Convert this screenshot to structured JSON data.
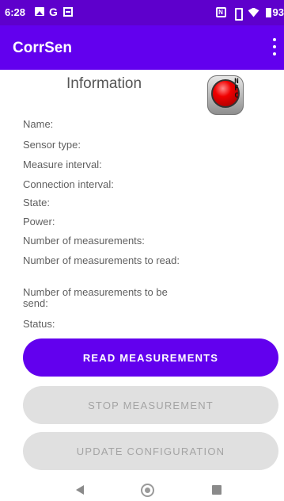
{
  "status_bar": {
    "time": "6:28",
    "google_letter": "G",
    "nfc_letter": "N",
    "battery": "93"
  },
  "app_bar": {
    "title": "CorrSen"
  },
  "info": {
    "title": "Information",
    "nfc_letters": [
      "N",
      "F",
      "C"
    ],
    "fields": [
      "Name:",
      "Sensor type:",
      "Measure interval:",
      "Connection interval:",
      "State:",
      "Power:",
      "Number of measurements:",
      "Number of measurements to read:",
      "Number of measurements to be send:",
      "Status:"
    ]
  },
  "buttons": {
    "read": "READ MEASUREMENTS",
    "stop": "STOP MEASUREMENT",
    "update": "UPDATE CONFIGURATION"
  },
  "colors": {
    "primary": "#6200ee",
    "status_bar": "#5e00cc",
    "disabled_bg": "#e0e0e0",
    "disabled_text": "#a4a4a4",
    "nfc_light": "#f00000"
  }
}
